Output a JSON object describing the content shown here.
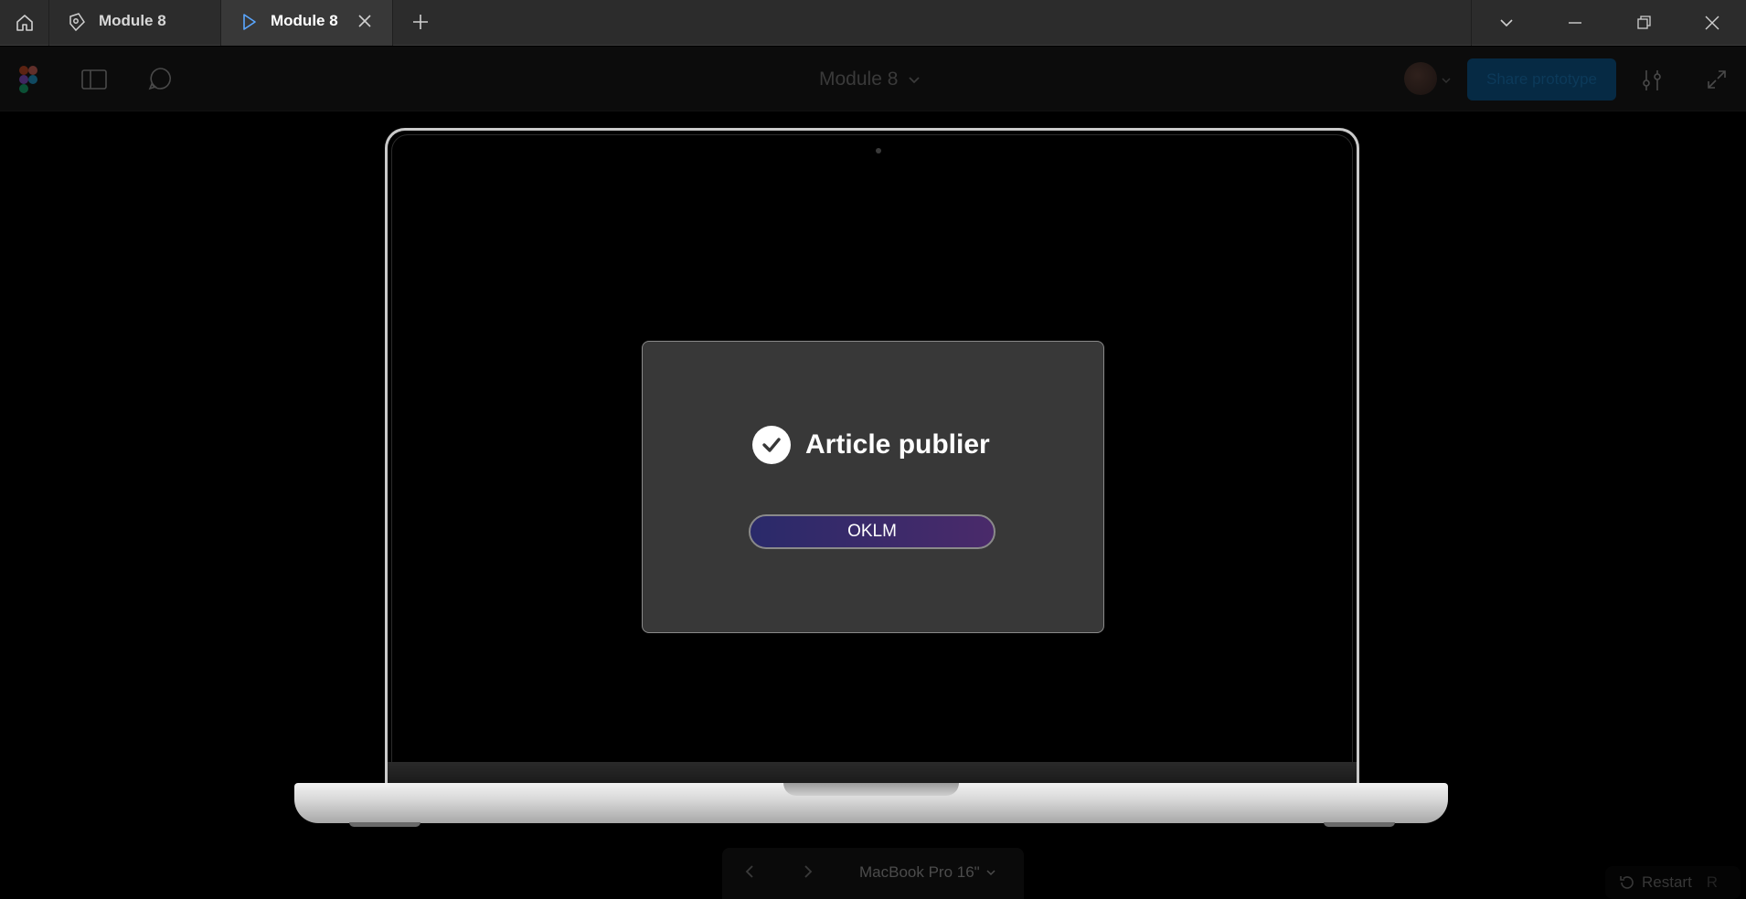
{
  "tabs": [
    {
      "label": "Module 8",
      "icon": "figma-file-icon"
    },
    {
      "label": "Module 8",
      "icon": "play-icon",
      "active": true
    }
  ],
  "toolbar": {
    "title": "Module 8",
    "share_label": "Share prototype"
  },
  "dialog": {
    "title": "Article publier",
    "button_label": "OKLM"
  },
  "bottom_nav": {
    "device": "MacBook Pro 16\""
  },
  "restart": {
    "label": "Restart",
    "shortcut": "R"
  },
  "colors": {
    "titlebar": "#2c2c2c",
    "dialog_bg": "#383838",
    "button_gradient_start": "#2a2a6a",
    "button_gradient_end": "#4a2a6a",
    "share_button": "#062a44"
  }
}
